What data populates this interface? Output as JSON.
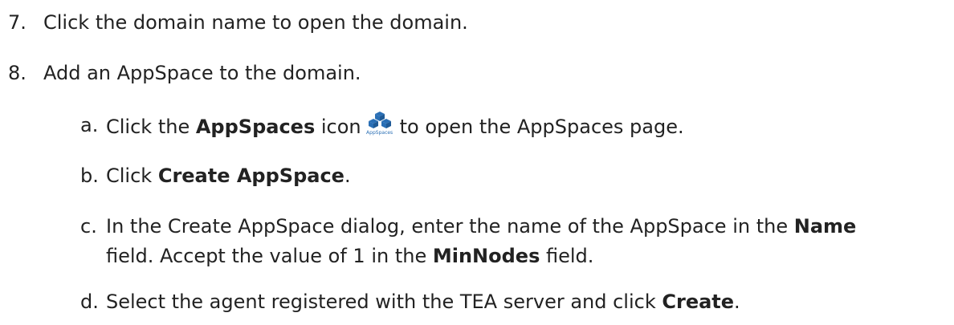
{
  "steps": [
    {
      "marker": "7.",
      "text": "Click the domain name to open the domain."
    },
    {
      "marker": "8.",
      "text": "Add an AppSpace to the domain.",
      "substeps": [
        {
          "marker": "a.",
          "pre": "Click the ",
          "bold": "AppSpaces",
          "mid": " icon",
          "icon": {
            "name": "appspaces-icon",
            "caption": "AppSpaces",
            "color": "#2a6fb5"
          },
          "post": "to open the AppSpaces page."
        },
        {
          "marker": "b.",
          "pre": "Click ",
          "bold": "Create AppSpace",
          "post": "."
        },
        {
          "marker": "c.",
          "line1_pre": "In the Create AppSpace dialog, enter the name of the AppSpace in the ",
          "line1_bold": "Name",
          "line2_pre": "field. Accept the value of 1 in the ",
          "line2_bold": "MinNodes",
          "line2_post": " field."
        },
        {
          "marker": "d.",
          "pre": "Select the agent registered with the TEA server and click ",
          "bold": "Create",
          "post": "."
        }
      ]
    }
  ]
}
